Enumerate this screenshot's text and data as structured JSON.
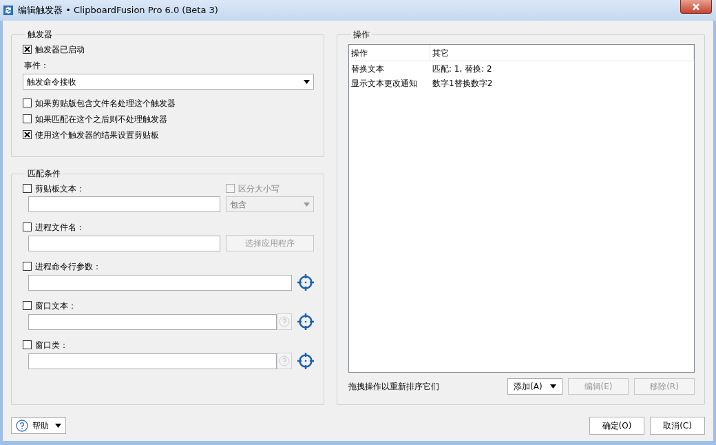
{
  "window": {
    "title": "编辑触发器 • ClipboardFusion Pro 6.0 (Beta 3)"
  },
  "trigger": {
    "title": "触发器",
    "enabled": {
      "label": "触发器已启动",
      "checked": true
    },
    "event_label": "事件：",
    "event_value": "触发命令接收",
    "options": [
      {
        "label": "如果剪贴版包含文件名处理这个触发器",
        "checked": false
      },
      {
        "label": "如果匹配在这个之后则不处理触发器",
        "checked": false
      },
      {
        "label": "使用这个触发器的结果设置剪贴板",
        "checked": true
      }
    ]
  },
  "match": {
    "title": "匹配条件",
    "conditions": [
      {
        "kind": "text-match",
        "label": "剪贴板文本：",
        "checked": false,
        "case_option": {
          "label": "区分大小写",
          "checked": false,
          "disabled": true
        },
        "match_mode": {
          "value": "包含",
          "disabled": true
        }
      },
      {
        "kind": "app-picker",
        "label": "进程文件名：",
        "checked": false,
        "button": {
          "label": "选择应用程序",
          "disabled": true
        }
      },
      {
        "kind": "finder",
        "label": "进程命令行参数：",
        "checked": false
      },
      {
        "kind": "finder-help",
        "label": "窗口文本：",
        "checked": false
      },
      {
        "kind": "finder-help",
        "label": "窗口类：",
        "checked": false
      }
    ]
  },
  "actions": {
    "title": "操作",
    "columns": [
      "操作",
      "其它"
    ],
    "rows": [
      [
        "替换文本",
        "匹配: 1, 替换: 2"
      ],
      [
        "显示文本更改通知",
        "数字1替换数字2"
      ]
    ],
    "hint": "拖拽操作以重新排序它们",
    "buttons": [
      {
        "label": "添加(A)",
        "dropdown": true,
        "disabled": false
      },
      {
        "label": "编辑(E)",
        "dropdown": false,
        "disabled": true
      },
      {
        "label": "移除(R)",
        "dropdown": false,
        "disabled": true
      }
    ]
  },
  "help_button": "帮助",
  "dialog_buttons": [
    "确定(O)",
    "取消(C)"
  ]
}
